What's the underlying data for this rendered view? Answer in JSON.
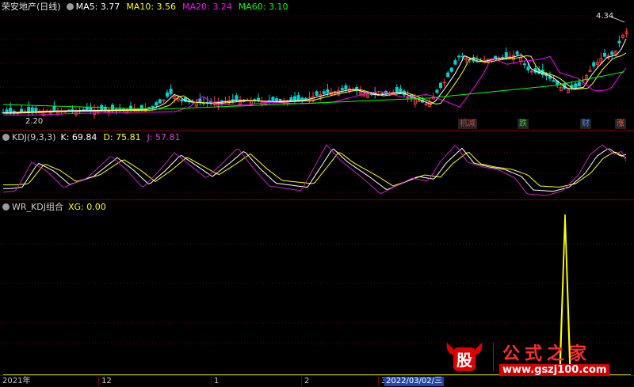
{
  "main_panel": {
    "circle_icon": "circle-icon",
    "stock_title": "荣安地产(日线)",
    "ma5": "MA5: 3.77",
    "ma10": "MA10: 3.56",
    "ma20": "MA20: 3.24",
    "ma60": "MA60: 3.10",
    "high_label": "4.34",
    "low_label": "2.20",
    "tags": [
      {
        "text": "机减",
        "color": "#c84040"
      },
      {
        "text": "跌",
        "color": "#3cc83c"
      },
      {
        "text": "财",
        "color": "#4a8cff"
      },
      {
        "text": "涨",
        "color": "#ff5050"
      }
    ]
  },
  "kdj_panel": {
    "title": "KDJ(9,3,3)",
    "k": "K: 69.84",
    "d": "D: 75.81",
    "j": "J: 57.81"
  },
  "wr_panel": {
    "title": "WR_KDJ组合",
    "xg": "XG: 0.00"
  },
  "time_axis": {
    "labels": [
      "2021年",
      "12",
      "1",
      "2",
      "3"
    ],
    "cursor_date": "2022/03/02/三"
  },
  "watermark": {
    "logo_text": "股",
    "title": "公式之家",
    "url": "www.gszj100.com"
  },
  "colors": {
    "up": "#ff3a3a",
    "down": "#00d2d2",
    "ma5": "#ffffff",
    "ma10": "#ffff00",
    "ma20": "#ff00ff",
    "ma60": "#00ff00",
    "k": "#ffffff",
    "d": "#ffff00",
    "j": "#c020c0",
    "grid": "#7a0000"
  }
}
